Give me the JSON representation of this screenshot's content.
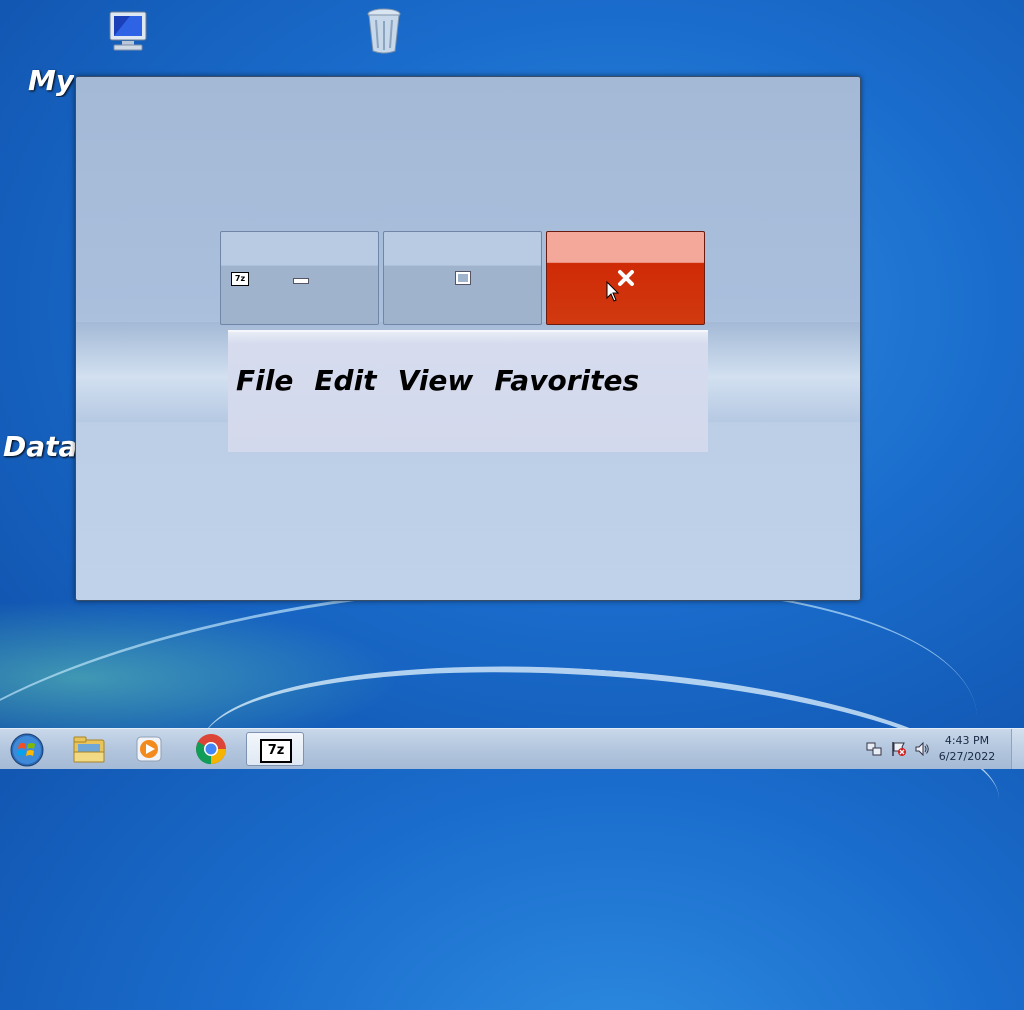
{
  "desktop": {
    "icons": [
      {
        "name": "computer-icon",
        "label": "My Computer"
      },
      {
        "name": "recycle-bin-icon",
        "label": "Recycle Bin"
      },
      {
        "name": "data-icon",
        "label": "Data"
      }
    ]
  },
  "window": {
    "app_icon": "7z",
    "menu": [
      "File",
      "Edit",
      "View",
      "Favorites"
    ]
  },
  "taskbar": {
    "buttons": [
      "start-button",
      "explorer",
      "media-player",
      "chrome",
      "7zip"
    ],
    "active_app_label": "7z",
    "clock": {
      "time": "4:43 PM",
      "date": "6/27/2022"
    }
  }
}
